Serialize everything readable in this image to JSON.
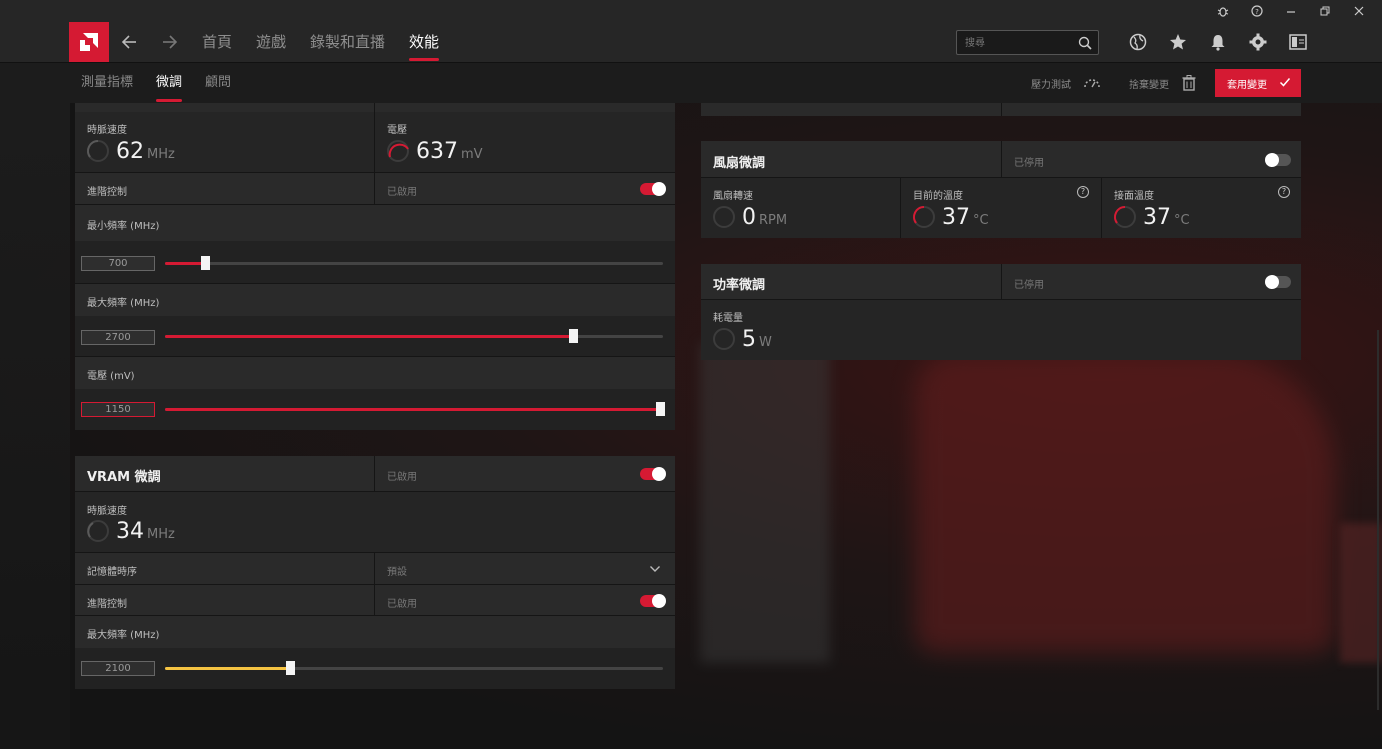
{
  "window": {
    "controls": [
      "bug-icon",
      "help-icon",
      "minimize-icon",
      "restore-icon",
      "close-icon"
    ]
  },
  "nav": {
    "tabs": [
      "首頁",
      "遊戲",
      "錄製和直播",
      "效能"
    ],
    "active_tab": "效能",
    "search_placeholder": "搜尋"
  },
  "subnav": {
    "tabs": [
      "測量指標",
      "微調",
      "顧問"
    ],
    "active_tab": "微調",
    "stress_test": "壓力測試",
    "discard": "捨棄變更",
    "apply": "套用變更"
  },
  "gpu": {
    "clock_label": "時脈速度",
    "clock_value": "62",
    "clock_unit": "MHz",
    "voltage_label": "電壓",
    "voltage_value": "637",
    "voltage_unit": "mV",
    "advanced_label": "進階控制",
    "advanced_state": "已啟用",
    "min_freq_label": "最小頻率 (MHz)",
    "min_freq_value": "700",
    "min_freq_fraction": 0.08,
    "max_freq_label": "最大頻率 (MHz)",
    "max_freq_value": "2700",
    "max_freq_fraction": 0.82,
    "voltage_mv_label": "電壓 (mV)",
    "voltage_mv_value": "1150",
    "voltage_mv_fraction": 1.0
  },
  "vram": {
    "title": "VRAM 微調",
    "state": "已啟用",
    "clock_label": "時脈速度",
    "clock_value": "34",
    "clock_unit": "MHz",
    "timing_label": "記憶體時序",
    "timing_value": "預設",
    "advanced_label": "進階控制",
    "advanced_state": "已啟用",
    "max_freq_label": "最大頻率 (MHz)",
    "max_freq_value": "2100",
    "max_freq_fraction": 0.25
  },
  "fan": {
    "title": "風扇微調",
    "state": "已停用",
    "speed_label": "風扇轉速",
    "speed_value": "0",
    "speed_unit": "RPM",
    "temp_label": "目前的溫度",
    "temp_value": "37",
    "temp_unit": "°C",
    "junction_label": "接面溫度",
    "junction_value": "37",
    "junction_unit": "°C"
  },
  "power": {
    "title": "功率微調",
    "state": "已停用",
    "consumption_label": "耗電量",
    "consumption_value": "5",
    "consumption_unit": "W"
  },
  "colors": {
    "accent": "#d51a33",
    "vram_slider": "#f5c342"
  }
}
